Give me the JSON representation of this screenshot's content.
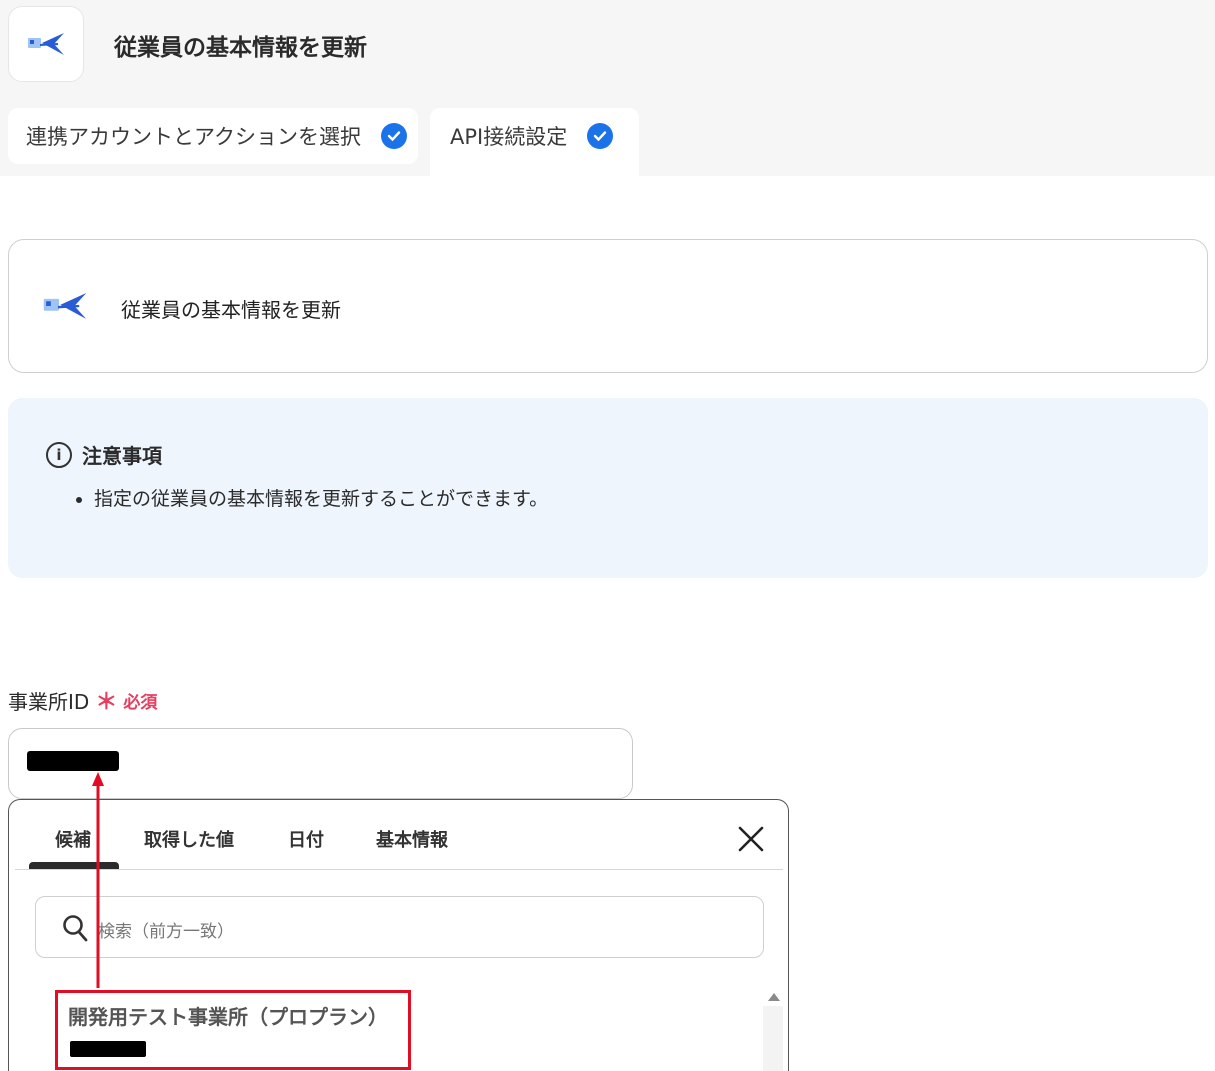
{
  "header": {
    "title": "従業員の基本情報を更新",
    "icon_name": "app-bird-icon",
    "tabs": [
      {
        "label": "連携アカウントとアクションを選択",
        "completed": true
      },
      {
        "label": "API接続設定",
        "completed": true,
        "active": true
      }
    ]
  },
  "action_card": {
    "title": "従業員の基本情報を更新",
    "icon_name": "app-bird-icon"
  },
  "notice": {
    "heading": "注意事項",
    "items": [
      "指定の従業員の基本情報を更新することができます。"
    ]
  },
  "field": {
    "label": "事業所ID",
    "required_mark": "＊",
    "required_text": "必須",
    "value_redacted": true
  },
  "dropdown": {
    "tabs": [
      "候補",
      "取得した値",
      "日付",
      "基本情報"
    ],
    "active_tab": "候補",
    "search_placeholder": "検索（前方一致）",
    "options": [
      {
        "name": "開発用テスト事業所（プロプラン）",
        "id_redacted": true
      }
    ]
  },
  "colors": {
    "accent_blue": "#1a73e8",
    "required_red": "#e53e5e",
    "highlight_red": "#e00d23",
    "notice_bg": "#eef5fd"
  }
}
